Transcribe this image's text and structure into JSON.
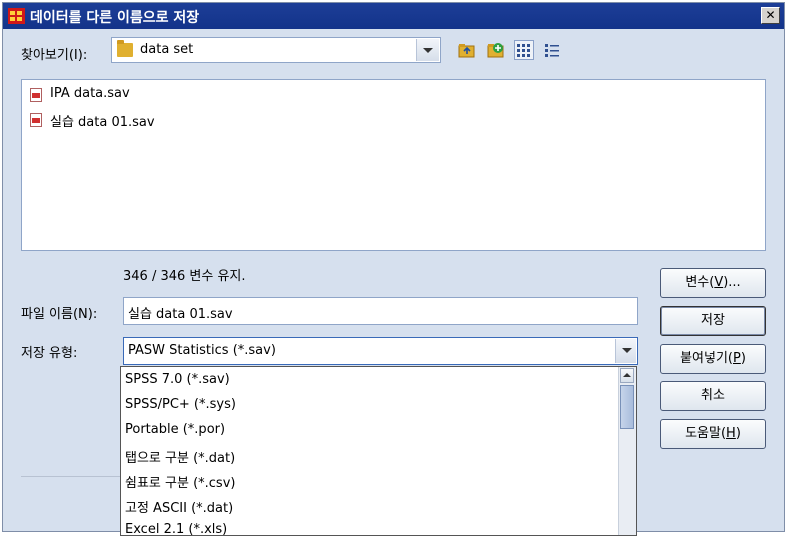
{
  "window": {
    "title": "데이터를 다른 이름으로 저장",
    "close": "✕"
  },
  "look_in": {
    "label": "찾아보기(I):",
    "value": "data set"
  },
  "files": [
    {
      "name": "IPA data.sav"
    },
    {
      "name": "실습 data 01.sav"
    }
  ],
  "status_text": "346 / 346 변수 유지.",
  "file_name": {
    "label": "파일 이름(N):",
    "value": "실습 data 01.sav"
  },
  "save_type": {
    "label": "저장 유형:",
    "value": "PASW Statistics (*.sav)"
  },
  "save_type_options": [
    "SPSS 7.0 (*.sav)",
    "SPSS/PC+ (*.sys)",
    "Portable (*.por)",
    "탭으로 구분 (*.dat)",
    "쉼표로 구분 (*.csv)",
    "고정 ASCII (*.dat)",
    "Excel 2.1 (*.xls)"
  ],
  "buttons": {
    "variables": {
      "text": "변수(",
      "key": "V",
      "suffix": ")..."
    },
    "save": {
      "text": "저장"
    },
    "paste": {
      "text": "붙여넣기(",
      "key": "P",
      "suffix": ")"
    },
    "cancel": {
      "text": "취소"
    },
    "help": {
      "text": "도움말(",
      "key": "H",
      "suffix": ")"
    }
  }
}
